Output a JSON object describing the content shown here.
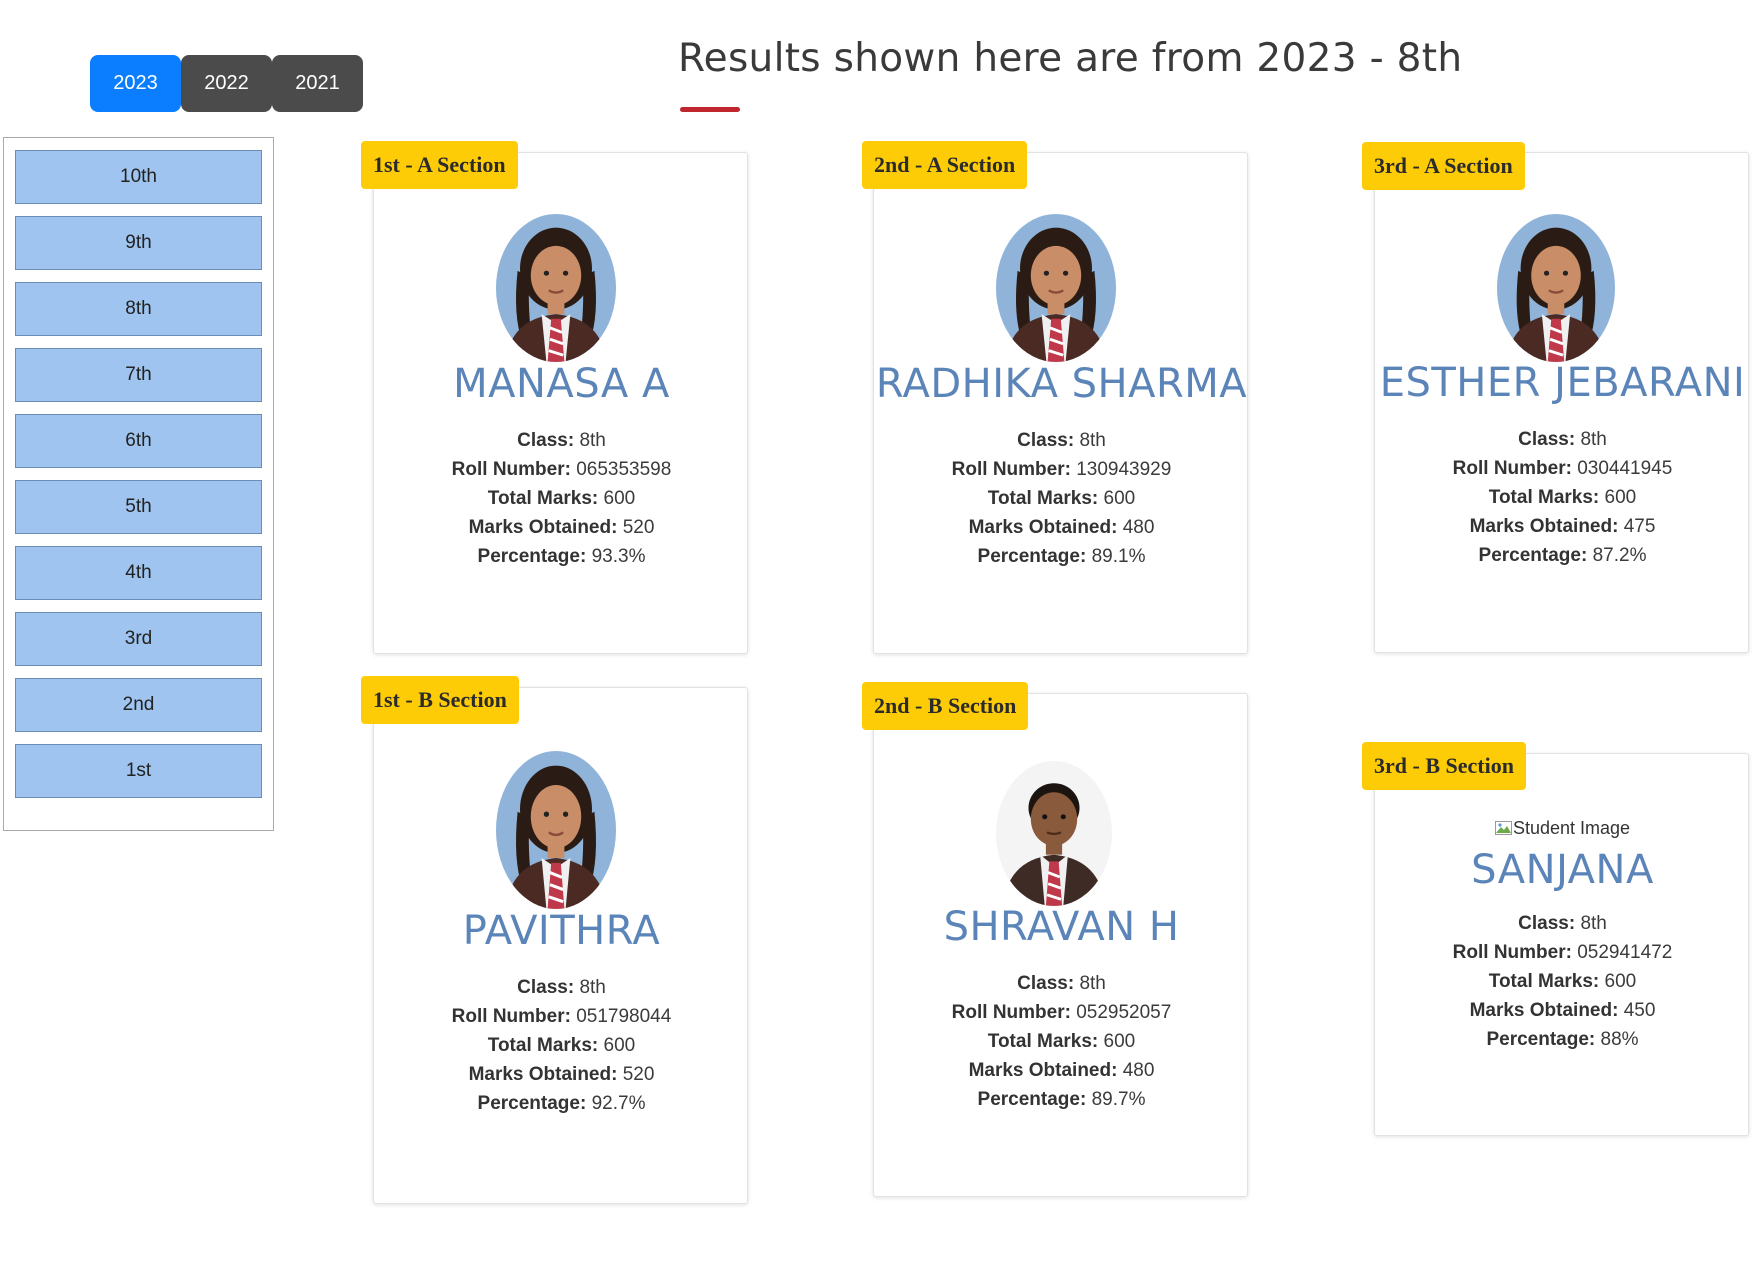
{
  "years": [
    "2023",
    "2022",
    "2021"
  ],
  "active_year": "2023",
  "heading": "Results shown here are from 2023 - 8th",
  "classes": [
    "10th",
    "9th",
    "8th",
    "7th",
    "6th",
    "5th",
    "4th",
    "3rd",
    "2nd",
    "1st"
  ],
  "labels": {
    "class": "Class:",
    "roll": "Roll Number:",
    "total": "Total Marks:",
    "obtained": "Marks Obtained:",
    "percentage": "Percentage:"
  },
  "students": [
    {
      "rank": "1st - A Section",
      "name": "MANASA A",
      "class": "8th",
      "roll": "065353598",
      "total": "600",
      "obtained": "520",
      "percentage": "93.3%",
      "photo": "girl-photo"
    },
    {
      "rank": "2nd - A Section",
      "name": "RADHIKA SHARMA",
      "class": "8th",
      "roll": "130943929",
      "total": "600",
      "obtained": "480",
      "percentage": "89.1%",
      "photo": "girl-photo"
    },
    {
      "rank": "3rd - A Section",
      "name": "ESTHER JEBARANI",
      "class": "8th",
      "roll": "030441945",
      "total": "600",
      "obtained": "475",
      "percentage": "87.2%",
      "photo": "girl-photo"
    },
    {
      "rank": "1st - B Section",
      "name": "PAVITHRA",
      "class": "8th",
      "roll": "051798044",
      "total": "600",
      "obtained": "520",
      "percentage": "92.7%",
      "photo": "girl-photo"
    },
    {
      "rank": "2nd - B Section",
      "name": "SHRAVAN H",
      "class": "8th",
      "roll": "052952057",
      "total": "600",
      "obtained": "480",
      "percentage": "89.7%",
      "photo": "boy-photo"
    },
    {
      "rank": "3rd - B Section",
      "name": "SANJANA",
      "class": "8th",
      "roll": "052941472",
      "total": "600",
      "obtained": "450",
      "percentage": "88%",
      "photo_alt": "Student Image"
    }
  ],
  "colors": {
    "active_tab": "#0b7dff",
    "inactive_tab": "#4b4b4b",
    "badge": "#fdcc06",
    "name": "#5b84b8",
    "class_button": "#9ec4ef",
    "underline": "#c0262d"
  }
}
